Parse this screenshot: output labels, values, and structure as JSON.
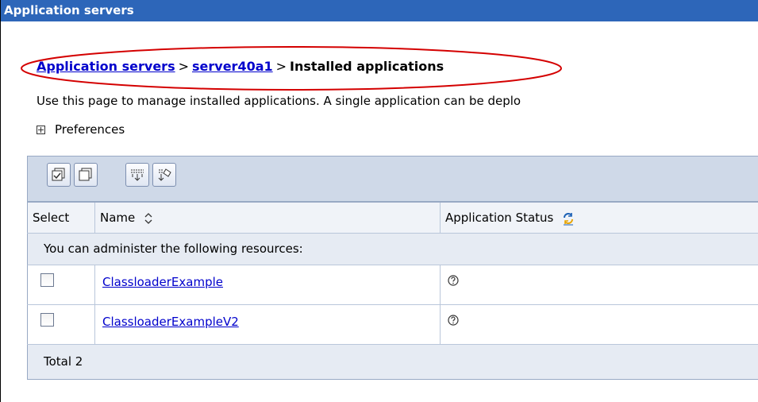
{
  "window": {
    "title": "Application servers"
  },
  "breadcrumb": {
    "link1": "Application servers",
    "sep1": ">",
    "link2": "server40a1",
    "sep2": ">",
    "current": "Installed applications"
  },
  "description": "Use this page to manage installed applications. A single application can be deplo",
  "preferences": {
    "label": "Preferences"
  },
  "table": {
    "toolbar": [
      "select-all-icon",
      "deselect-all-icon",
      "expand-all-icon",
      "collapse-all-icon"
    ],
    "headers": {
      "select": "Select",
      "name": "Name",
      "status": "Application Status"
    },
    "admin_message": "You can administer the following resources:",
    "rows": [
      {
        "name": "ClassloaderExample",
        "status_icon": "unknown-status-icon"
      },
      {
        "name": "ClassloaderExampleV2",
        "status_icon": "unknown-status-icon"
      }
    ],
    "total": "Total 2"
  },
  "colors": {
    "title_bar": "#2d66b9",
    "link": "#0000cc",
    "highlight": "#d40000",
    "table_header_bg": "#cfd9e8"
  }
}
